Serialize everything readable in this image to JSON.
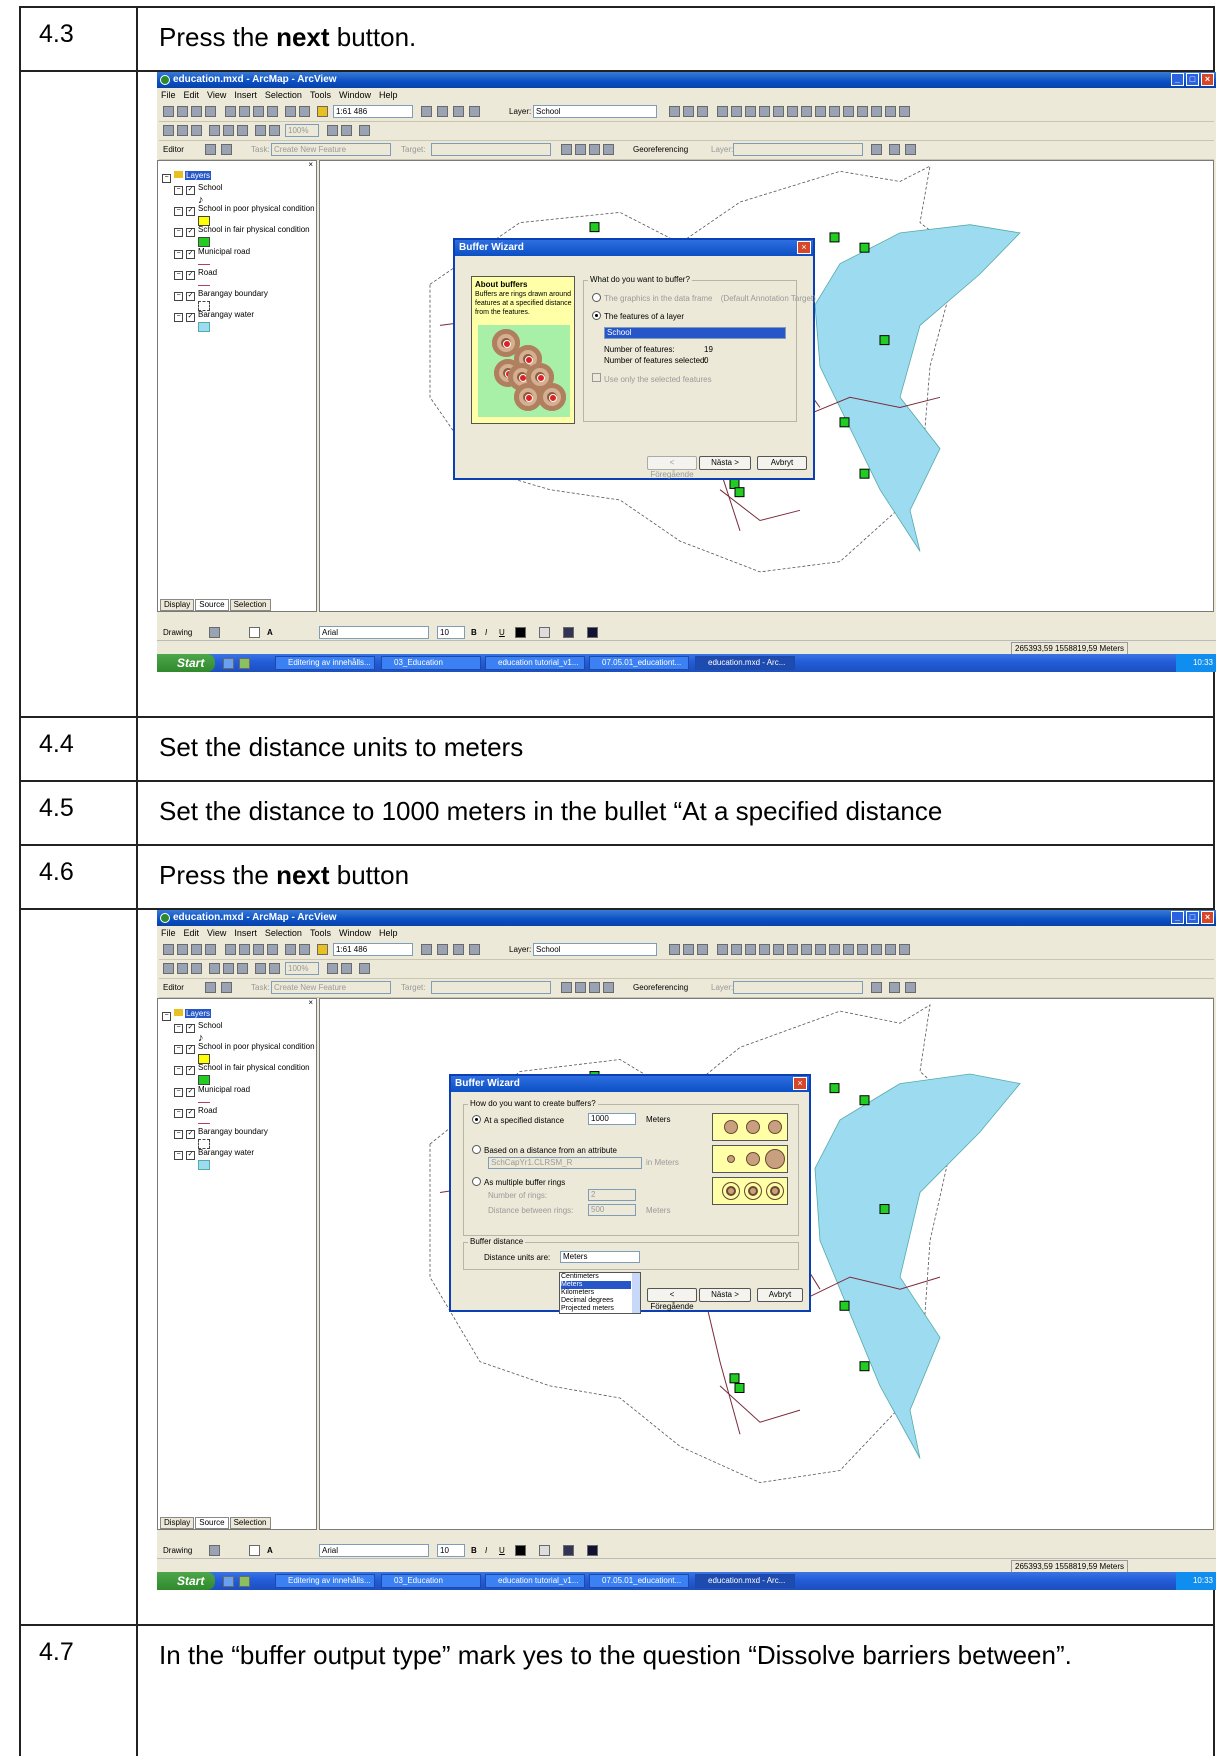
{
  "steps": [
    {
      "num": "4.3",
      "text_pre": "Press the ",
      "text_bold": "next",
      "text_post": " button."
    },
    {
      "num": "4.4",
      "text": "Set the distance units to meters"
    },
    {
      "num": "4.5",
      "text": "Set the distance to 1000 meters in the bullet “At a specified distance"
    },
    {
      "num": "4.6",
      "text_pre": "Press the ",
      "text_bold": "next",
      "text_post": " button"
    },
    {
      "num": "4.7",
      "text": "In the “buffer output type” mark yes to the question “Dissolve barriers between”."
    }
  ],
  "app": {
    "title": "education.mxd - ArcMap - ArcView",
    "menu": [
      "File",
      "Edit",
      "View",
      "Insert",
      "Selection",
      "Tools",
      "Window",
      "Help"
    ],
    "scale": "1:61 486",
    "layer_label": "Layer:",
    "layer_value": "School",
    "zoom_value": "100%",
    "editor_label": "Editor",
    "task_label": "Task:",
    "task_value": "Create New Feature",
    "target_label": "Target:",
    "georef_label": "Georeferencing",
    "georef_layer_label": "Layer:",
    "toc": {
      "root": "Layers",
      "layers": [
        "School",
        "School in poor physical condition",
        "School in fair physical condition",
        "Municipal road",
        "Road",
        "Barangay boundary",
        "Barangay water"
      ]
    },
    "tabs": [
      "Display",
      "Source",
      "Selection"
    ],
    "drawing_label": "Drawing",
    "font_name": "Arial",
    "font_size": "10",
    "coords": "265393,59  1558819,59 Meters",
    "taskbar": {
      "start": "Start",
      "buttons": [
        "Editering av innehålls...",
        "03_Education",
        "education tutorial_v1...",
        "07.05.01_educationt...",
        "education.mxd - Arc..."
      ],
      "clock": "10:33"
    }
  },
  "dialog1": {
    "title": "Buffer Wizard",
    "about_title": "About buffers",
    "about_text": "Buffers are rings drawn around features at a specified distance from the features.",
    "question": "What do you want to buffer?",
    "opt_graphics": "The graphics in the data frame",
    "opt_graphics_note": "(Default Annotation Target)",
    "opt_features": "The features of a layer",
    "layer_value": "School",
    "num_features_label": "Number of features:",
    "num_features_value": "19",
    "num_selected_label": "Number of features selected:",
    "num_selected_value": "0",
    "use_selected": "Use only the selected features",
    "btn_back": "< Föregående",
    "btn_next": "Nästa >",
    "btn_cancel": "Avbryt"
  },
  "dialog2": {
    "title": "Buffer Wizard",
    "question": "How do you want to create buffers?",
    "opt_distance": "At a specified distance",
    "distance_value": "1000",
    "distance_units": "Meters",
    "opt_attribute": "Based on a distance from an attribute",
    "attribute_value": "SchCapYr1.CLRSM_R",
    "attribute_units": "in Meters",
    "opt_multiple": "As multiple buffer rings",
    "rings_label": "Number of rings:",
    "rings_value": "2",
    "between_label": "Distance between rings:",
    "between_value": "500",
    "between_units": "Meters",
    "group_buffer_distance": "Buffer distance",
    "units_label": "Distance units are:",
    "units_value": "Meters",
    "units_options": [
      "Centimeters",
      "Meters",
      "Kilometers",
      "Decimal degrees",
      "Projected meters"
    ],
    "btn_back": "< Föregående",
    "btn_next": "Nästa >",
    "btn_cancel": "Avbryt"
  },
  "colors": {
    "water": "#9ddcf0",
    "school_green": "#22cc22",
    "poor_yellow": "#ffff00",
    "road": "#7a2a3a",
    "xp_blue": "#0a4fc4"
  }
}
